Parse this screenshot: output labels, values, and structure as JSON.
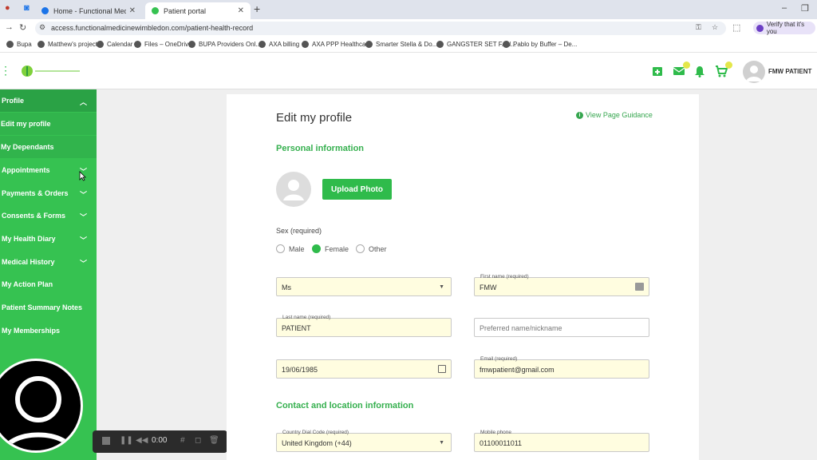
{
  "browser": {
    "tabs": [
      {
        "label": "Home - Functional Medicine W..."
      },
      {
        "label": "Patient portal"
      }
    ],
    "url": "access.functionalmedicinewimbledon.com/patient-health-record",
    "verify_label": "Verify that it's you",
    "bookmarks": [
      "Bupa",
      "Matthew's project",
      "Calendar",
      "Files – OneDrive",
      "BUPA  Providers Onl...",
      "AXA billing",
      "AXA PPP Healthcare",
      "Smarter Stella & Do...",
      "GANGSTER SET FAN...",
      "Pablo by Buffer – De..."
    ]
  },
  "header": {
    "user_name": "FMW PATIENT"
  },
  "sidebar": {
    "items": [
      {
        "label": "Profile"
      },
      {
        "label": "Edit my profile"
      },
      {
        "label": "My Dependants"
      },
      {
        "label": "Appointments"
      },
      {
        "label": "Payments & Orders"
      },
      {
        "label": "Consents & Forms"
      },
      {
        "label": "My Health Diary"
      },
      {
        "label": "Medical History"
      },
      {
        "label": "My Action Plan"
      },
      {
        "label": "Patient Summary Notes"
      },
      {
        "label": "My Memberships"
      }
    ]
  },
  "recorder": {
    "time": "0:00"
  },
  "main": {
    "title": "Edit my profile",
    "guidance_link": "View Page Guidance",
    "personal_heading": "Personal information",
    "upload_button": "Upload Photo",
    "sex_label": "Sex (required)",
    "sex_options": [
      "Male",
      "Female",
      "Other"
    ],
    "sex_selected": "Female",
    "fields": {
      "title_value": "Ms",
      "first_name_label": "First name (required)",
      "first_name_value": "FMW",
      "last_name_label": "Last name (required)",
      "last_name_value": "PATIENT",
      "preferred_placeholder": "Preferred name/nickname",
      "dob_value": "19/06/1985",
      "email_label": "Email (required)",
      "email_value": "fmwpatient@gmail.com",
      "dial_code_label": "Country Dial Code (required)",
      "dial_code_value": "United Kingdom (+44)",
      "mobile_label": "Mobile phone",
      "mobile_value": "01100011011"
    },
    "contact_heading": "Contact and location information"
  }
}
